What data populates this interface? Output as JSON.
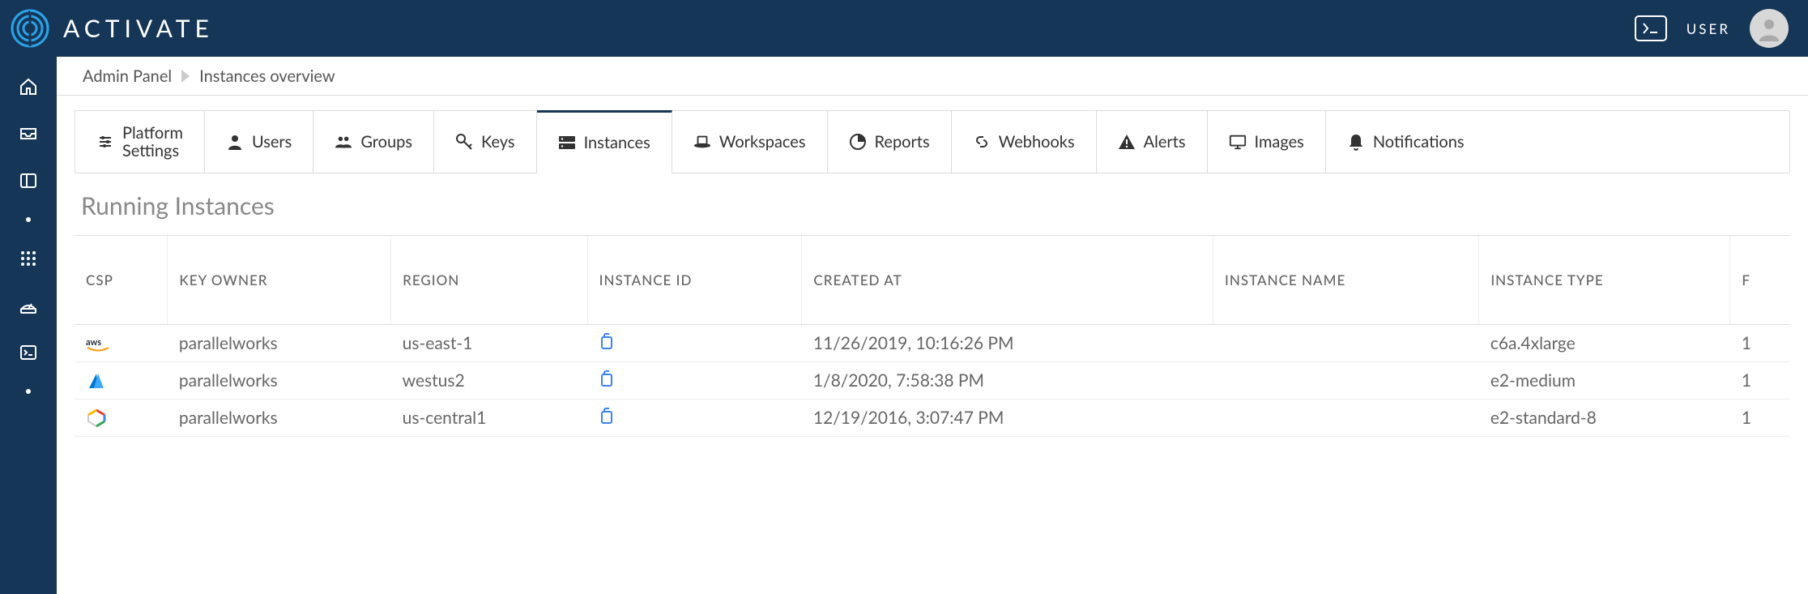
{
  "brand": "ACTIVATE",
  "user_label": "USER",
  "breadcrumbs": [
    "Admin Panel",
    "Instances overview"
  ],
  "tabs": [
    {
      "id": "platform-settings",
      "label": "Platform\nSettings",
      "icon": "sliders",
      "active": false
    },
    {
      "id": "users",
      "label": "Users",
      "icon": "user",
      "active": false
    },
    {
      "id": "groups",
      "label": "Groups",
      "icon": "group",
      "active": false
    },
    {
      "id": "keys",
      "label": "Keys",
      "icon": "key",
      "active": false
    },
    {
      "id": "instances",
      "label": "Instances",
      "icon": "server",
      "active": true
    },
    {
      "id": "workspaces",
      "label": "Workspaces",
      "icon": "workspace",
      "active": false
    },
    {
      "id": "reports",
      "label": "Reports",
      "icon": "piechart",
      "active": false
    },
    {
      "id": "webhooks",
      "label": "Webhooks",
      "icon": "link",
      "active": false
    },
    {
      "id": "alerts",
      "label": "Alerts",
      "icon": "alert",
      "active": false
    },
    {
      "id": "images",
      "label": "Images",
      "icon": "monitor",
      "active": false
    },
    {
      "id": "notifications",
      "label": "Notifications",
      "icon": "bell",
      "active": false
    }
  ],
  "section_title": "Running Instances",
  "columns": [
    "CSP",
    "KEY OWNER",
    "REGION",
    "INSTANCE ID",
    "CREATED AT",
    "INSTANCE NAME",
    "INSTANCE TYPE",
    "F"
  ],
  "rows": [
    {
      "csp": "aws",
      "key_owner": "parallelworks",
      "region": "us-east-1",
      "instance_id": "",
      "created_at": "11/26/2019, 10:16:26 PM",
      "instance_name": "",
      "instance_type": "c6a.4xlarge",
      "last": "1"
    },
    {
      "csp": "azure",
      "key_owner": "parallelworks",
      "region": "westus2",
      "instance_id": "",
      "created_at": "1/8/2020, 7:58:38 PM",
      "instance_name": "",
      "instance_type": "e2-medium",
      "last": "1"
    },
    {
      "csp": "gcp",
      "key_owner": "parallelworks",
      "region": "us-central1",
      "instance_id": "",
      "created_at": "12/19/2016, 3:07:47 PM",
      "instance_name": "",
      "instance_type": "e2-standard-8",
      "last": "1"
    }
  ]
}
